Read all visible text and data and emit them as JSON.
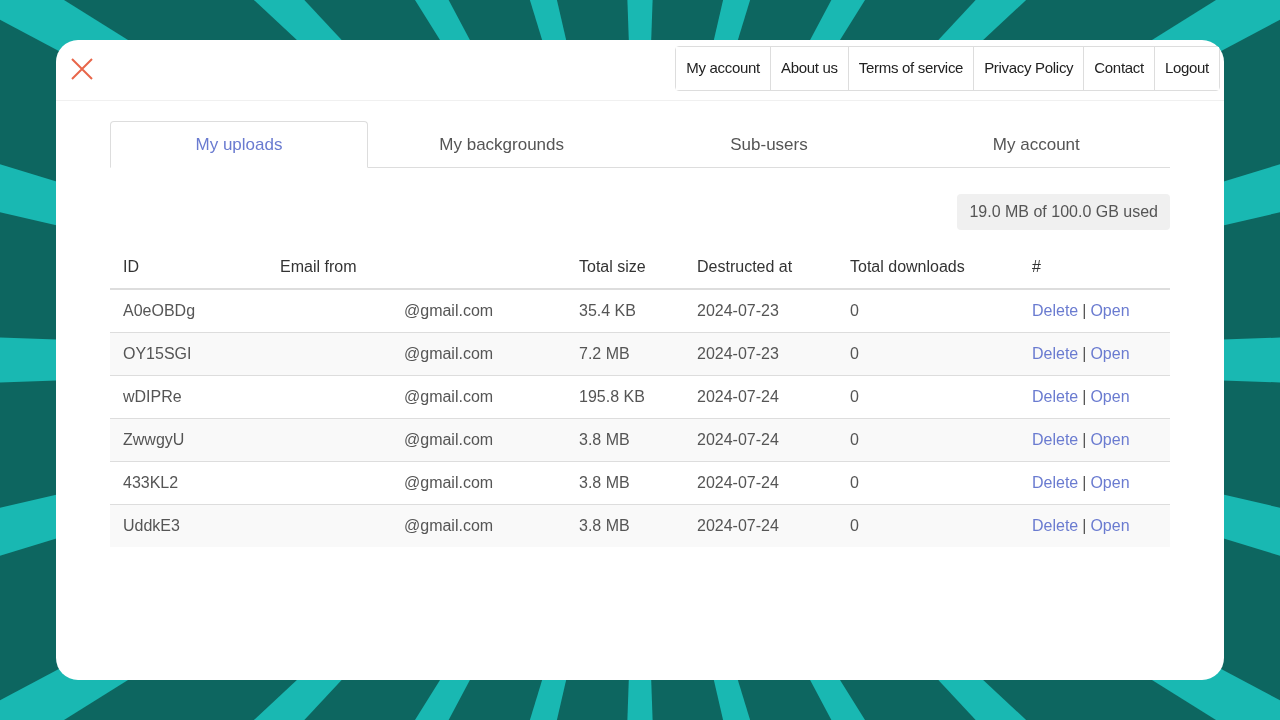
{
  "top_nav": [
    {
      "label": "My account"
    },
    {
      "label": "About us"
    },
    {
      "label": "Terms of service"
    },
    {
      "label": "Privacy Policy"
    },
    {
      "label": "Contact"
    },
    {
      "label": "Logout"
    }
  ],
  "tabs": [
    {
      "label": "My uploads",
      "selected": true
    },
    {
      "label": "My backgrounds",
      "selected": false
    },
    {
      "label": "Sub-users",
      "selected": false
    },
    {
      "label": "My account",
      "selected": false
    }
  ],
  "usage": "19.0 MB of 100.0 GB used",
  "table": {
    "columns": [
      "ID",
      "Email from",
      "Total size",
      "Destructed at",
      "Total downloads",
      "#"
    ],
    "rows": [
      {
        "id": "A0eOBDg",
        "email": "@gmail.com",
        "total_size": "35.4 KB",
        "destructed_at": "2024-07-23",
        "total_downloads": "0",
        "actions": [
          "Delete",
          "Open"
        ],
        "separator": "|"
      },
      {
        "id": "OY15SGI",
        "email": "@gmail.com",
        "total_size": "7.2 MB",
        "destructed_at": "2024-07-23",
        "total_downloads": "0",
        "actions": [
          "Delete",
          "Open"
        ],
        "separator": "|"
      },
      {
        "id": "wDIPRe",
        "email": "@gmail.com",
        "total_size": "195.8 KB",
        "destructed_at": "2024-07-24",
        "total_downloads": "0",
        "actions": [
          "Delete",
          "Open"
        ],
        "separator": "|"
      },
      {
        "id": "ZwwgyU",
        "email": "@gmail.com",
        "total_size": "3.8 MB",
        "destructed_at": "2024-07-24",
        "total_downloads": "0",
        "actions": [
          "Delete",
          "Open"
        ],
        "separator": "|"
      },
      {
        "id": "433KL2",
        "email": "@gmail.com",
        "total_size": "3.8 MB",
        "destructed_at": "2024-07-24",
        "total_downloads": "0",
        "actions": [
          "Delete",
          "Open"
        ],
        "separator": "|"
      },
      {
        "id": "UddkE3",
        "email": "@gmail.com",
        "total_size": "3.8 MB",
        "destructed_at": "2024-07-24",
        "total_downloads": "0",
        "actions": [
          "Delete",
          "Open"
        ],
        "separator": "|"
      }
    ]
  }
}
